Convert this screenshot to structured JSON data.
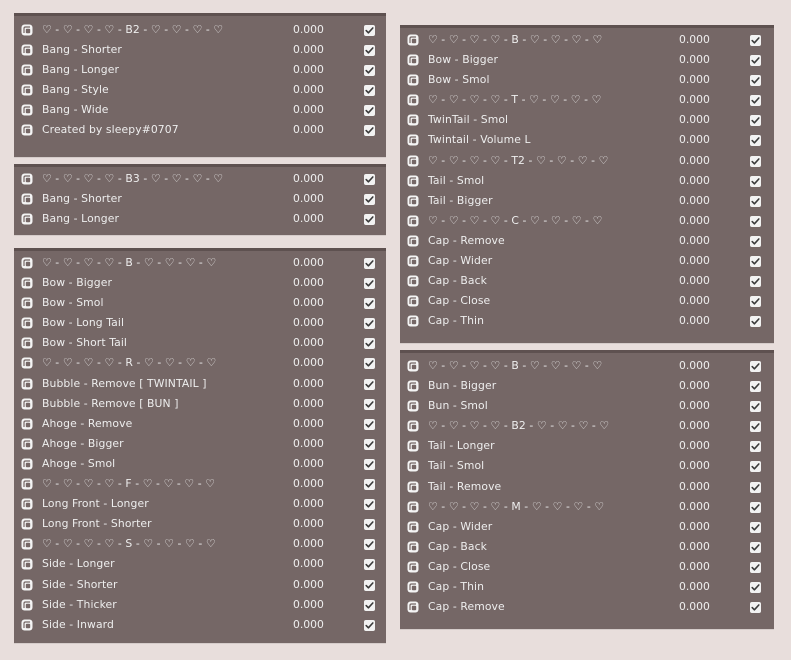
{
  "panels": [
    {
      "id": "panel-b2-left",
      "rows": [
        {
          "label": "♡ - ♡ - ♡ - ♡ - B2 - ♡ - ♡ - ♡ - ♡",
          "value": "0.000",
          "checked": true
        },
        {
          "label": "Bang - Shorter",
          "value": "0.000",
          "checked": true
        },
        {
          "label": "Bang - Longer",
          "value": "0.000",
          "checked": true
        },
        {
          "label": "Bang - Style",
          "value": "0.000",
          "checked": true
        },
        {
          "label": "Bang - Wide",
          "value": "0.000",
          "checked": true
        },
        {
          "label": "Created by sleepy#0707",
          "value": "0.000",
          "checked": true
        }
      ]
    },
    {
      "id": "panel-b3-left",
      "rows": [
        {
          "label": "♡ - ♡ - ♡ - ♡ - B3 - ♡ - ♡ - ♡ - ♡",
          "value": "0.000",
          "checked": true
        },
        {
          "label": "Bang - Shorter",
          "value": "0.000",
          "checked": true
        },
        {
          "label": "Bang - Longer",
          "value": "0.000",
          "checked": true
        }
      ]
    },
    {
      "id": "panel-b-left",
      "rows": [
        {
          "label": "♡ - ♡ - ♡ - ♡ - B - ♡ - ♡ - ♡ - ♡",
          "value": "0.000",
          "checked": true
        },
        {
          "label": "Bow - Bigger",
          "value": "0.000",
          "checked": true
        },
        {
          "label": "Bow - Smol",
          "value": "0.000",
          "checked": true
        },
        {
          "label": "Bow - Long Tail",
          "value": "0.000",
          "checked": true
        },
        {
          "label": "Bow - Short Tail",
          "value": "0.000",
          "checked": true
        },
        {
          "label": "♡ - ♡ - ♡ - ♡ - R - ♡ - ♡ - ♡ - ♡",
          "value": "0.000",
          "checked": true
        },
        {
          "label": "Bubble - Remove [ TWINTAIL ]",
          "value": "0.000",
          "checked": true
        },
        {
          "label": "Bubble - Remove [ BUN ]",
          "value": "0.000",
          "checked": true
        },
        {
          "label": "Ahoge - Remove",
          "value": "0.000",
          "checked": true
        },
        {
          "label": "Ahoge - Bigger",
          "value": "0.000",
          "checked": true
        },
        {
          "label": "Ahoge - Smol",
          "value": "0.000",
          "checked": true
        },
        {
          "label": "♡ - ♡ - ♡ - ♡ - F - ♡ - ♡ - ♡ - ♡",
          "value": "0.000",
          "checked": true
        },
        {
          "label": "Long Front - Longer",
          "value": "0.000",
          "checked": true
        },
        {
          "label": "Long Front - Shorter",
          "value": "0.000",
          "checked": true
        },
        {
          "label": "♡ - ♡ - ♡ - ♡ - S - ♡ - ♡ - ♡ - ♡",
          "value": "0.000",
          "checked": true
        },
        {
          "label": "Side - Longer",
          "value": "0.000",
          "checked": true
        },
        {
          "label": "Side - Shorter",
          "value": "0.000",
          "checked": true
        },
        {
          "label": "Side - Thicker",
          "value": "0.000",
          "checked": true
        },
        {
          "label": "Side - Inward",
          "value": "0.000",
          "checked": true
        }
      ]
    },
    {
      "id": "panel-b-right",
      "rows": [
        {
          "label": "♡ - ♡ - ♡ - ♡ - B - ♡ - ♡ - ♡ - ♡",
          "value": "0.000",
          "checked": true
        },
        {
          "label": "Bow - Bigger",
          "value": "0.000",
          "checked": true
        },
        {
          "label": "Bow - Smol",
          "value": "0.000",
          "checked": true
        },
        {
          "label": "♡ - ♡ - ♡ - ♡ - T - ♡ - ♡ - ♡ - ♡",
          "value": "0.000",
          "checked": true
        },
        {
          "label": "TwinTail - Smol",
          "value": "0.000",
          "checked": true
        },
        {
          "label": "Twintail - Volume L",
          "value": "0.000",
          "checked": true
        },
        {
          "label": "♡ - ♡ - ♡ - ♡ - T2 - ♡ - ♡ - ♡ - ♡",
          "value": "0.000",
          "checked": true
        },
        {
          "label": "Tail - Smol",
          "value": "0.000",
          "checked": true
        },
        {
          "label": "Tail - Bigger",
          "value": "0.000",
          "checked": true
        },
        {
          "label": "♡ - ♡ - ♡ - ♡ - C - ♡ - ♡ - ♡ - ♡",
          "value": "0.000",
          "checked": true
        },
        {
          "label": "Cap - Remove",
          "value": "0.000",
          "checked": true
        },
        {
          "label": "Cap - Wider",
          "value": "0.000",
          "checked": true
        },
        {
          "label": "Cap - Back",
          "value": "0.000",
          "checked": true
        },
        {
          "label": "Cap - Close",
          "value": "0.000",
          "checked": true
        },
        {
          "label": "Cap - Thin",
          "value": "0.000",
          "checked": true
        }
      ]
    },
    {
      "id": "panel-b2-right",
      "rows": [
        {
          "label": "♡ - ♡ - ♡ - ♡ - B - ♡ - ♡ - ♡ - ♡",
          "value": "0.000",
          "checked": true
        },
        {
          "label": "Bun - Bigger",
          "value": "0.000",
          "checked": true
        },
        {
          "label": "Bun - Smol",
          "value": "0.000",
          "checked": true
        },
        {
          "label": "♡ - ♡ - ♡ - ♡ - B2 - ♡ - ♡ - ♡ - ♡",
          "value": "0.000",
          "checked": true
        },
        {
          "label": "Tail - Longer",
          "value": "0.000",
          "checked": true
        },
        {
          "label": "Tail - Smol",
          "value": "0.000",
          "checked": true
        },
        {
          "label": "Tail - Remove",
          "value": "0.000",
          "checked": true
        },
        {
          "label": "♡ - ♡ - ♡ - ♡ - M - ♡ - ♡ - ♡ - ♡",
          "value": "0.000",
          "checked": true
        },
        {
          "label": "Cap - Wider",
          "value": "0.000",
          "checked": true
        },
        {
          "label": "Cap - Back",
          "value": "0.000",
          "checked": true
        },
        {
          "label": "Cap - Close",
          "value": "0.000",
          "checked": true
        },
        {
          "label": "Cap - Thin",
          "value": "0.000",
          "checked": true
        },
        {
          "label": "Cap - Remove",
          "value": "0.000",
          "checked": true
        }
      ]
    }
  ],
  "colors": {
    "background": "#e8dedc",
    "panel": "#756766",
    "text": "#eeeeee",
    "checkbox": "#f2f2f2"
  },
  "icons": {
    "row_icon": "shape-key-icon",
    "check_icon": "checkmark-icon"
  }
}
